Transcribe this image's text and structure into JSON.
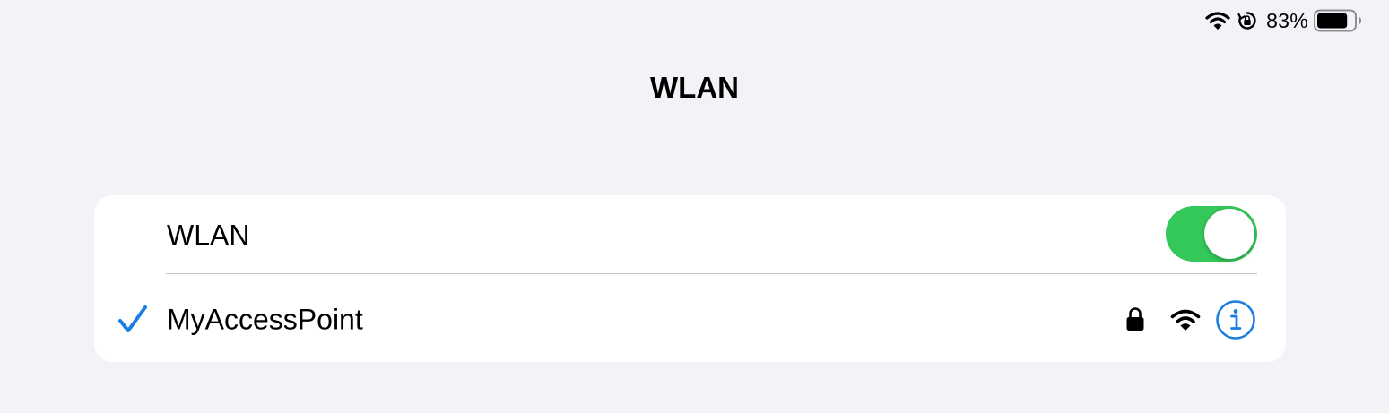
{
  "status_bar": {
    "battery_percent": "83%",
    "battery_level": 0.83,
    "icons": [
      "wifi-icon",
      "orientation-lock-icon",
      "battery-icon"
    ]
  },
  "page": {
    "title": "WLAN"
  },
  "wlan_row": {
    "label": "WLAN",
    "toggle_on": true
  },
  "network_row": {
    "name": "MyAccessPoint",
    "connected": true,
    "icons": [
      "checkmark-icon",
      "lock-icon",
      "wifi-signal-icon",
      "info-icon"
    ]
  },
  "colors": {
    "background": "#f2f2f7",
    "card": "#ffffff",
    "toggle_on": "#34c759",
    "accent_blue": "#1a7fe0",
    "divider": "#c6c6c8"
  }
}
